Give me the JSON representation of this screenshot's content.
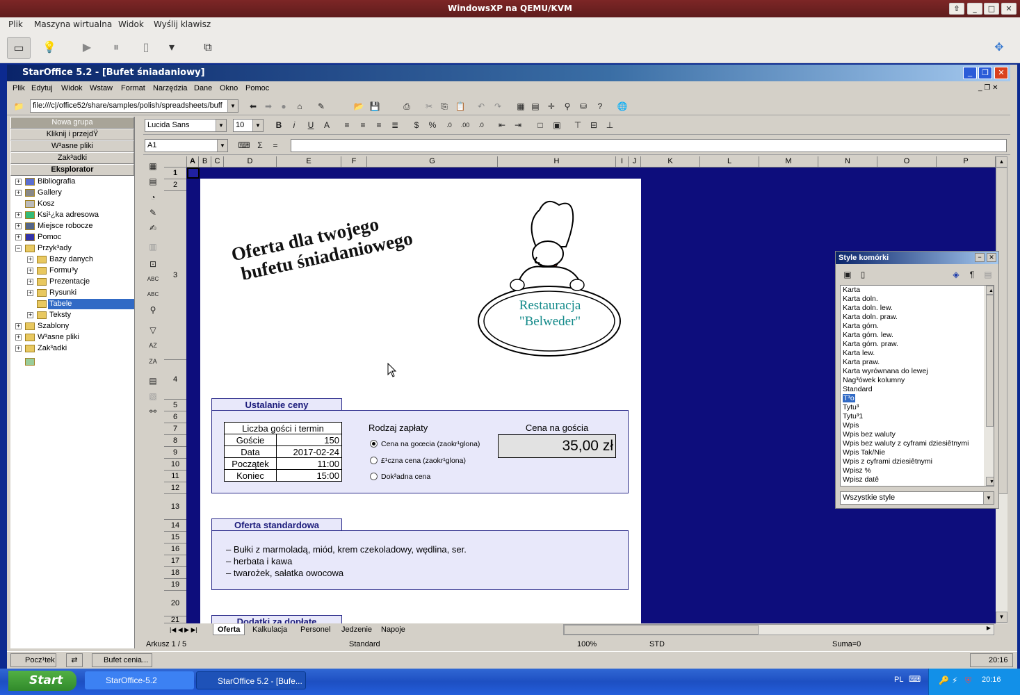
{
  "host": {
    "title": "WindowsXP na QEMU/KVM",
    "menu": [
      "Plik",
      "Maszyna wirtualna",
      "Widok",
      "Wyślij klawisz"
    ]
  },
  "app": {
    "title": "StarOffice 5.2 - [Bufet śniadaniowy]",
    "menu": [
      "Plik",
      "Edytuj",
      "Widok",
      "Wstaw",
      "Format",
      "Narzędzia",
      "Dane",
      "Okno",
      "Pomoc"
    ],
    "url": "file:///c|/office52/share/samples/polish/spreadsheets/buff",
    "font": "Lucida Sans",
    "font_size": "10",
    "cell_ref": "A1"
  },
  "explorer": {
    "groups": [
      "Nowa grupa",
      "Kliknij i przejdŸ",
      "W³asne pliki",
      "Zak³adki",
      "Eksplorator"
    ],
    "tree": [
      "Bibliografia",
      "Gallery",
      "Kosz",
      "Ksi¹¿ka adresowa",
      "Miejsce robocze",
      "Pomoc",
      "Przyk³ady",
      "Bazy danych",
      "Formu³y",
      "Prezentacje",
      "Rysunki",
      "Tabele",
      "Teksty",
      "Szablony",
      "W³asne pliki",
      "Zak³adki"
    ]
  },
  "columns": [
    "A",
    "B",
    "C",
    "D",
    "E",
    "F",
    "G",
    "H",
    "I",
    "J",
    "K",
    "L",
    "M",
    "N",
    "O",
    "P"
  ],
  "rows": [
    "1",
    "2",
    "3",
    "4",
    "5",
    "6",
    "7",
    "8",
    "9",
    "10",
    "11",
    "12",
    "13",
    "14",
    "15",
    "16",
    "17",
    "18",
    "19",
    "20",
    "21"
  ],
  "sheet": {
    "headline1": "Oferta dla twojego",
    "headline2": "bufetu śniadaniowego",
    "restaurant1": "Restauracja",
    "restaurant2": "\"Belweder\"",
    "pricing_title": "Ustalanie ceny",
    "guests_header": "Liczba gości i termin",
    "guests_rows": [
      [
        "Goście",
        "150"
      ],
      [
        "Data",
        "2017-02-24"
      ],
      [
        "Początek",
        "11:00"
      ],
      [
        "Koniec",
        "15:00"
      ]
    ],
    "payment_label": "Rodzaj zapłaty",
    "payment_options": [
      "Cena na goœcia (zaokr¹glona)",
      "£¹czna cena (zaokr¹glona)",
      "Dok³adna cena"
    ],
    "price_label": "Cena na gościa",
    "price_value": "35,00 zł",
    "standard_title": "Oferta standardowa",
    "standard_items": [
      "– Bułki z marmoladą, miód, krem czekoladowy, wędlina, ser.",
      "– herbata i kawa",
      "– twarożek, sałatka owocowa"
    ],
    "extras_title": "Dodatki za dopłatę"
  },
  "styles_panel": {
    "title": "Style komórki",
    "items": [
      "Karta",
      "Karta doln.",
      "Karta doln. lew.",
      "Karta doln. praw.",
      "Karta górn.",
      "Karta górn. lew.",
      "Karta górn. praw.",
      "Karta lew.",
      "Karta praw.",
      "Karta wyrównana do lewej",
      "Nag³ówek kolumny",
      "Standard",
      "T³o",
      "Tytu³",
      "Tytu³1",
      "Wpis",
      "Wpis bez waluty",
      "Wpis bez waluty z cyframi dziesiêtnymi",
      "Wpis Tak/Nie",
      "Wpis z cyframi dziesiêtnymi",
      "Wpisz %",
      "Wpisz datê"
    ],
    "filter": "Wszystkie style"
  },
  "tabs": [
    "Oferta",
    "Kalkulacja",
    "Personel",
    "Jedzenie",
    "Napoje"
  ],
  "status": {
    "sheet": "Arkusz 1 / 5",
    "style": "Standard",
    "zoom": "100%",
    "mode": "STD",
    "sum": "Suma=0"
  },
  "inner_taskbar": {
    "start": "Pocz¹tek",
    "task": "Bufet cenia...",
    "clock": "20:16"
  },
  "xp_taskbar": {
    "start": "Start",
    "tasks": [
      "StarOffice-5.2",
      "StarOffice 5.2 - [Bufe..."
    ],
    "lang": "PL",
    "clock": "20:16"
  }
}
